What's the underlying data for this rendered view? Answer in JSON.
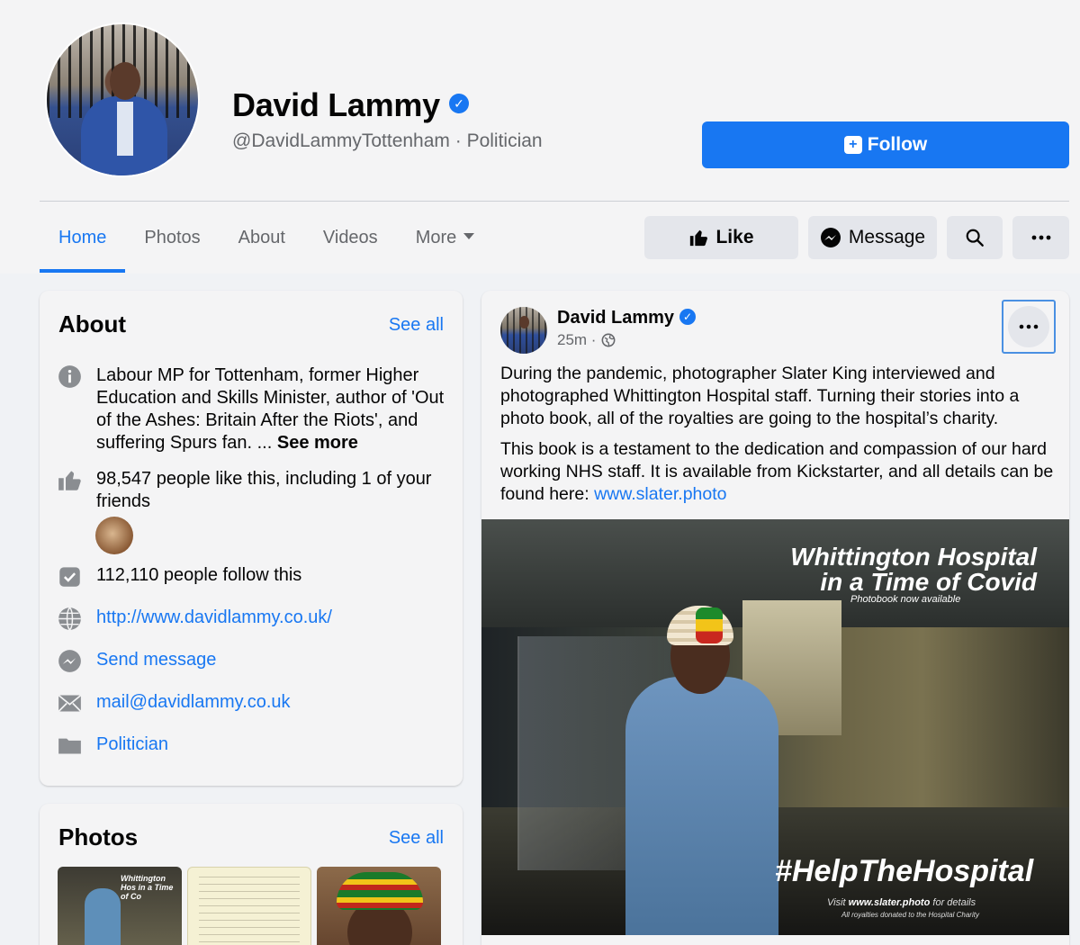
{
  "header": {
    "name": "David Lammy",
    "handle": "@DavidLammyTottenham · Politician",
    "follow_label": "Follow"
  },
  "tabs": [
    {
      "label": "Home",
      "active": true
    },
    {
      "label": "Photos"
    },
    {
      "label": "About"
    },
    {
      "label": "Videos"
    },
    {
      "label": "More"
    }
  ],
  "actions": {
    "like": "Like",
    "message": "Message"
  },
  "about": {
    "title": "About",
    "see_all": "See all",
    "intro": "Labour MP for Tottenham, former Higher Education and Skills Minister, author of 'Out of the Ashes: Britain After the Riots', and suffering Spurs fan. ...",
    "see_more": "See more",
    "likes": "98,547 people like this, including 1 of your friends",
    "follows": "112,110 people follow this",
    "website": "http://www.davidlammy.co.uk/",
    "send_message": "Send message",
    "email": "mail@davidlammy.co.uk",
    "category": "Politician"
  },
  "photos": {
    "title": "Photos",
    "see_all": "See all",
    "thumb1_caption": "Whittington Hos in a Time of Co"
  },
  "post": {
    "author": "David Lammy",
    "time": "25m ·",
    "para1": "During the pandemic, photographer Slater King interviewed and photographed Whittington Hospital staff. Turning their stories into a photo book, all of the royalties are going to the hospital’s charity.",
    "para2_text": "This book is a testament to the dedication and compassion of our hard working NHS staff. It is available from Kickstarter, and all details can be found here:",
    "para2_link": "www.slater.photo",
    "image": {
      "title_line1": "Whittington Hospital",
      "title_line2": "in a Time of Covid",
      "subtitle": "Photobook now available",
      "hashtag": "#HelpTheHospital",
      "visit_pre": "Visit",
      "visit_link": "www.slater.photo",
      "visit_post": "for details",
      "royalties": "All royalties donated to the Hospital Charity"
    }
  },
  "colors": {
    "accent": "#1877f2",
    "secondary_text": "#65676b",
    "button_gray": "#e4e6eb"
  }
}
